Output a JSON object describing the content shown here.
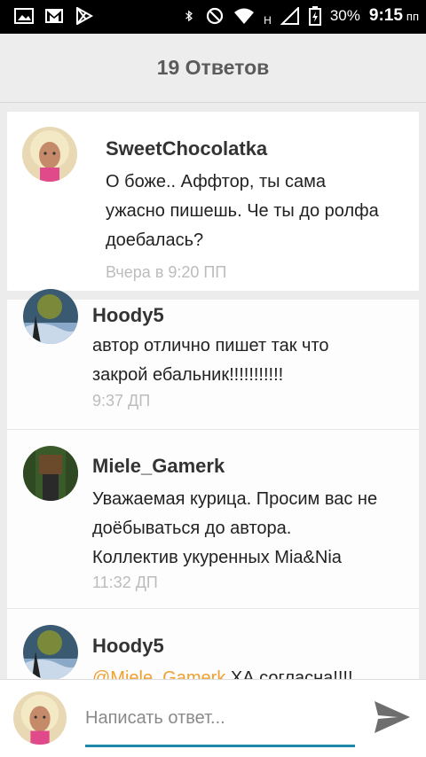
{
  "status_bar": {
    "network_label": "H",
    "battery": "30%",
    "time": "9:15",
    "time_suffix": "пп"
  },
  "header": {
    "title": "19 Ответов"
  },
  "comments": [
    {
      "author": "SweetChocolatka",
      "lines": [
        "О боже.. Аффтор, ты сама",
        "ужасно пишешь. Че ты до ролфа",
        "доебалась?"
      ],
      "time": "Вчера в 9:20 ПП"
    },
    {
      "author": "Hoody5",
      "lines": [
        "автор отлично пишет так что",
        "закрой ебальник!!!!!!!!!!!"
      ],
      "time": "9:37 ДП"
    },
    {
      "author": "Miele_Gamerk",
      "lines": [
        "Уважаемая курица. Просим вас не",
        "доёбываться до автора.",
        "Коллектив укуренных Mia&Nia"
      ],
      "time": "11:32 ДП"
    },
    {
      "author": "Hoody5",
      "mention": "@Miele_Gamerk",
      "text_after_mention": " ХА согласна!!!!"
    }
  ],
  "composer": {
    "placeholder": "Написать ответ..."
  },
  "colors": {
    "accent": "#1e88a8",
    "mention": "#f0a030",
    "time": "#bcbcbc"
  }
}
